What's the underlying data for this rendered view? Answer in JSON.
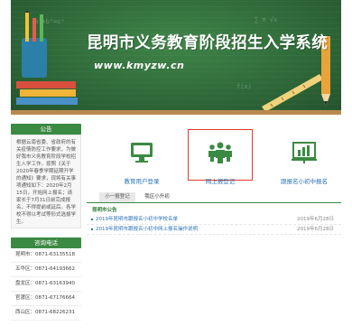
{
  "banner": {
    "title": "昆明市义务教育阶段招生入学系统",
    "url": "www.kmyzw.cn"
  },
  "sidebar": {
    "notice_heading": "公告",
    "notice_text": "根据云南省委、省政府的有关疫情防控工作要求，为做好我市义务教育阶段学校招生入学工作，按照《关于2020年春季学期延期开学的通知》要求，现将有关事项通知如下：2020年2月15日，开始网上报名；请家长于7月31日前完成报名，不得提前或延后。各学校不得以考试等形式选拔学生。",
    "hotline_heading": "咨询电话",
    "phones": [
      "昆明市：0871-63135518",
      "五华区：0871-64193662",
      "盘龙区：0871-63163940",
      "官渡区：0871-67176664",
      "西山区：0871-68226231"
    ]
  },
  "main": {
    "tiles": [
      {
        "label": "教育用户登录",
        "icon": "computer-icon"
      },
      {
        "label": "网上报登记",
        "icon": "people-icon"
      },
      {
        "label": "跟报名小初中报名",
        "icon": "chart-board-icon"
      }
    ],
    "tabs": [
      "小一报登记",
      "我区小升初"
    ],
    "news_heading": "昆明市公告",
    "news": [
      {
        "title": "2019年昆明市跟报名小初中学校名单",
        "date": "2019年6月28日"
      },
      {
        "title": "2019年昆明市跟报名小初中网上报名操作说明",
        "date": "2019年6月28日"
      }
    ]
  },
  "colors": {
    "banner_green": "#2f6b3b",
    "accent_green": "#3b8a43",
    "link_blue": "#2a72b8",
    "highlight_red": "#e23a2c"
  }
}
